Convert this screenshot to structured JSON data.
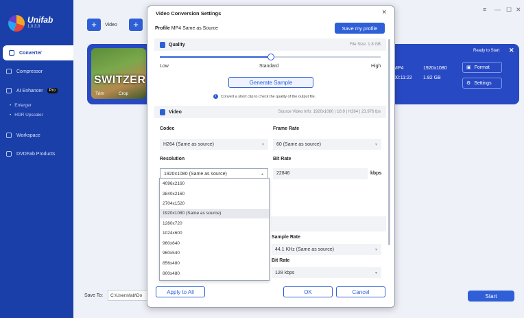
{
  "app": {
    "name": "Unifab",
    "version": "1.0.3.0"
  },
  "sidebar": {
    "items": [
      {
        "label": "Converter"
      },
      {
        "label": "Compressor"
      },
      {
        "label": "AI Enhancer",
        "badge": "Pro"
      },
      {
        "label": "Workspace"
      },
      {
        "label": "DVDFab Products"
      }
    ],
    "sub_items": [
      {
        "label": "Enlarger"
      },
      {
        "label": "HDR Upscaler"
      }
    ]
  },
  "toolbar": {
    "video_label": "Video"
  },
  "task": {
    "thumb_title": "SWITZER",
    "trim_label": "Trim",
    "crop_label": "Crop",
    "status": "Ready to Start",
    "format": "MP4",
    "resolution": "1920x1080",
    "duration": "00:11:22",
    "size": "1.82 GB",
    "format_btn": "Format",
    "settings_btn": "Settings"
  },
  "footer": {
    "save_to_label": "Save To:",
    "save_path": "C:\\Users\\fab\\Do",
    "start_label": "Start"
  },
  "dialog": {
    "title": "Video Conversion Settings",
    "profile_label": "Profile",
    "profile_value": "MP4 Same as Source",
    "save_profile_btn": "Save my profile",
    "quality": {
      "header": "Quality",
      "file_size": "File Size:  1.8 GB",
      "low": "Low",
      "standard": "Standard",
      "high": "High",
      "level": 0.5,
      "gen_btn": "Generate Sample",
      "gen_hint": "Convert a short clip to check the quality of the output file."
    },
    "video": {
      "header": "Video",
      "source_info": "Source Video Info: 1920x1080 | 16:9 | H264 | 23.976 fps",
      "codec_label": "Codec",
      "codec_value": "H264 (Same as source)",
      "framerate_label": "Frame Rate",
      "framerate_value": "60 (Same as source)",
      "resolution_label": "Resolution",
      "resolution_value": "1920x1080 (Same as source)",
      "bitrate_label": "Bit Rate",
      "bitrate_value": "22846",
      "bitrate_unit": "kbps"
    },
    "resolution_options": [
      "4096x2160",
      "3840x2160",
      "2704x1520",
      "1920x1080 (Same as source)",
      "1280x720",
      "1024x600",
      "960x640",
      "960x540",
      "856x480",
      "800x480"
    ],
    "audio": {
      "sample_rate_label": "Sample Rate",
      "sample_rate_value": "44.1 KHz (Same as source)",
      "bitrate_label": "Bit Rate",
      "bitrate_value": "128 kbps"
    },
    "apply_all_btn": "Apply to All",
    "ok_btn": "OK",
    "cancel_btn": "Cancel"
  }
}
